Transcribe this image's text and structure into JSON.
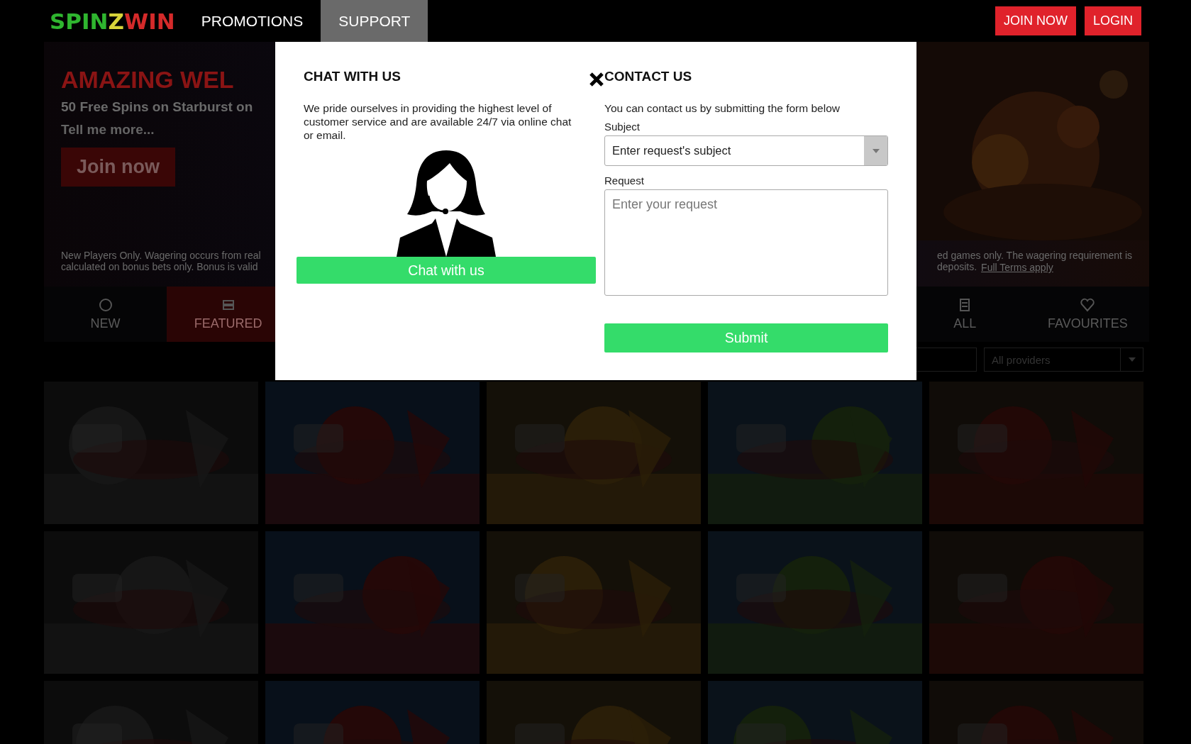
{
  "header": {
    "logo": [
      {
        "text": "SPIN",
        "color": "#2fb52f"
      },
      {
        "text": "Z",
        "color": "#d8d43a"
      },
      {
        "text": "WIN",
        "color": "#d42a2a"
      }
    ],
    "nav": [
      {
        "label": "PROMOTIONS",
        "selected": false
      },
      {
        "label": "SUPPORT",
        "selected": true
      }
    ],
    "buttons": [
      "JOIN NOW",
      "LOGIN"
    ]
  },
  "banner": {
    "heading": "AMAZING WEL",
    "subtitle": "50 Free Spins on Starburst on",
    "link": "Tell me more...",
    "button": "Join now",
    "terms_left": [
      "New Players Only. Wagering occurs from real",
      "calculated on bonus bets only. Bonus is valid"
    ],
    "terms_right": [
      "ed games only. The wagering requirement is",
      "deposits."
    ],
    "terms_link": "Full Terms apply"
  },
  "categories": [
    {
      "label": "NEW",
      "selected": false
    },
    {
      "label": "FEATURED",
      "selected": true
    },
    {
      "label": "ALL",
      "selected": false
    },
    {
      "label": "FAVOURITES",
      "selected": false
    }
  ],
  "filters": {
    "provider": "All providers"
  },
  "modal": {
    "chat": {
      "title": "CHAT WITH US",
      "text": "We pride ourselves in providing the highest level of customer service and are available 24/7 via online chat or email.",
      "button": "Chat with us"
    },
    "contact": {
      "title": "CONTACT US",
      "text": "You can contact us by submitting the form below",
      "subject": {
        "label": "Subject",
        "value": "Enter request's subject"
      },
      "request": {
        "label": "Request",
        "placeholder": "Enter your request"
      },
      "button": "Submit"
    }
  }
}
